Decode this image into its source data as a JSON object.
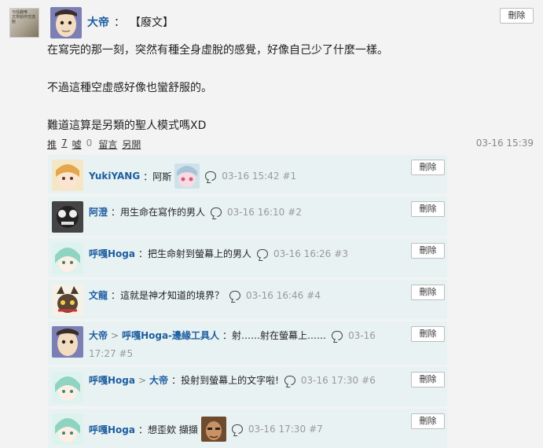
{
  "board": {
    "thumb_text": "与情趣唯\n文學創作交流館",
    "thumb_icon": "board-thumbnail-icon"
  },
  "post": {
    "author": "大帝",
    "colon": "：",
    "tag": "【廢文】",
    "delete_label": "刪除",
    "lines": [
      "在寫完的那一刻，突然有種全身虛脫的感覺，好像自己少了什麼一樣。",
      "",
      "不過這種空虛感好像也蠻舒服的。",
      "",
      "難道這算是另類的聖人模式嗎XD"
    ],
    "actions": {
      "push": "推",
      "push_count": "7",
      "boo": "噓",
      "boo_count": "0",
      "comment": "留言",
      "open": "另開"
    },
    "timestamp": "03-16 15:39"
  },
  "replies": [
    {
      "author": "YukiYANG",
      "text": "：阿斯",
      "has_sticker": true,
      "time": "03-16 15:42",
      "floor": "#1",
      "delete_label": "刪除"
    },
    {
      "author": "阿澄",
      "text": "：用生命在寫作的男人",
      "time": "03-16 16:10",
      "floor": "#2",
      "delete_label": "刪除"
    },
    {
      "author": "呼嘎Hoga",
      "text": "：把生命射到螢幕上的男人",
      "time": "03-16 16:26",
      "floor": "#3",
      "delete_label": "刪除"
    },
    {
      "author": "文龍",
      "text": "：這就是神才知道的境界？",
      "time": "03-16 16:46",
      "floor": "#4",
      "delete_label": "刪除"
    },
    {
      "author": "大帝",
      "arrow": ">",
      "target": "呼嘎Hoga-邊緣工具人",
      "text": "：射……射在螢幕上……",
      "time_part1": "03-16",
      "time_part2": "17:27",
      "floor": "#5",
      "delete_label": "刪除"
    },
    {
      "author": "呼嘎Hoga",
      "arrow": ">",
      "target": "大帝",
      "text": "：投射到螢幕上的文字啦!",
      "time": "03-16 17:30",
      "floor": "#6",
      "delete_label": "刪除"
    },
    {
      "author": "呼嘎Hoga",
      "text": "：想歪欸 擷擷",
      "has_sticker": true,
      "time": "03-16 17:30",
      "floor": "#7",
      "delete_label": "刪除"
    }
  ]
}
